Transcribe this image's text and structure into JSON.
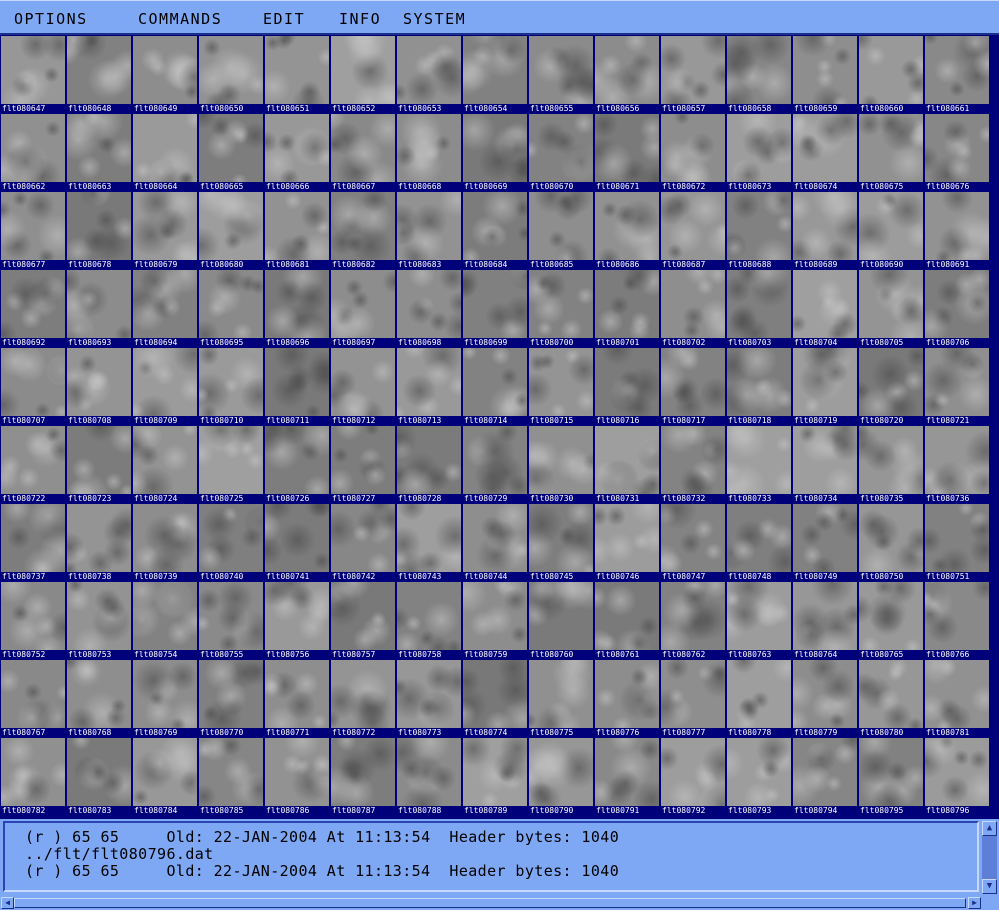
{
  "menu": {
    "items": [
      "OPTIONS",
      "COMMANDS",
      "EDIT",
      "INFO",
      "SYSTEM"
    ]
  },
  "gallery": {
    "prefix": "flt",
    "first_index": 80647,
    "last_index": 80796,
    "columns": 15,
    "rows": 10
  },
  "console": {
    "lines": [
      "(r ) 65 65     Old: 22-JAN-2004 At 11:13:54  Header bytes: 1040",
      "../flt/flt080796.dat",
      "(r ) 65 65     Old: 22-JAN-2004 At 11:13:54  Header bytes: 1040"
    ]
  },
  "icons": {
    "scroll_up": "arrow-up-icon",
    "scroll_down": "arrow-down-icon",
    "scroll_left": "arrow-left-icon",
    "scroll_right": "arrow-right-icon"
  },
  "colors": {
    "chrome": "#7fa8f4",
    "chrome_dark": "#1a2f8a",
    "gallery_background": "#00007a",
    "label_text": "#ffffff"
  }
}
